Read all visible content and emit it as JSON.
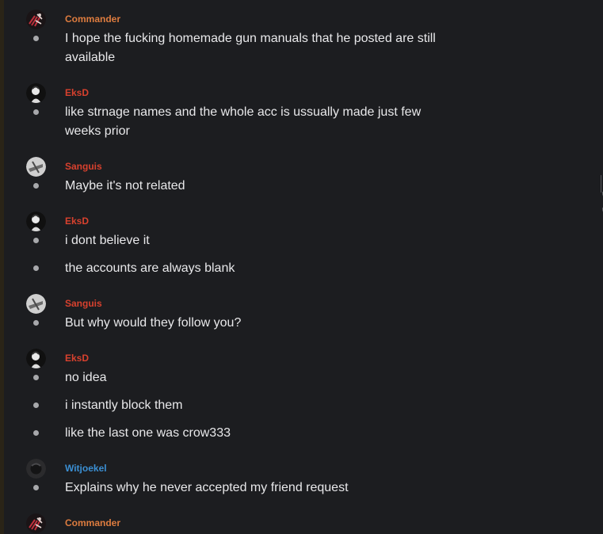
{
  "authors": {
    "commander": "Commander",
    "eksd": "EksD",
    "sanguis": "Sanguis",
    "witjoekel": "Witjoekel"
  },
  "colors": {
    "background": "#1c1d20",
    "text": "#e8e8ea",
    "author_orange": "#de7c3f",
    "author_red": "#d8412e",
    "author_blue": "#3b8fd3",
    "bullet": "#a7a8ab"
  },
  "messages": [
    {
      "author": "Commander",
      "lines": [
        "I hope the fucking homemade gun manuals that he posted are still",
        "available"
      ]
    },
    {
      "author": "EksD",
      "lines": [
        "like strnage names and the whole acc is ussually made just few",
        "weeks prior"
      ]
    },
    {
      "author": "Sanguis",
      "lines": [
        "Maybe it's not related"
      ]
    },
    {
      "author": "EksD",
      "lines": [
        "i dont believe it"
      ]
    },
    {
      "author": "EksD",
      "lines": [
        "the accounts are always blank"
      ]
    },
    {
      "author": "Sanguis",
      "lines": [
        "But why would they follow you?"
      ]
    },
    {
      "author": "EksD",
      "lines": [
        "no idea"
      ]
    },
    {
      "author": "EksD",
      "lines": [
        "i instantly block them"
      ]
    },
    {
      "author": "EksD",
      "lines": [
        "like the last one was crow333"
      ]
    },
    {
      "author": "Witjoekel",
      "lines": [
        "Explains why he never accepted my friend request"
      ]
    },
    {
      "author": "Commander",
      "lines": []
    }
  ]
}
